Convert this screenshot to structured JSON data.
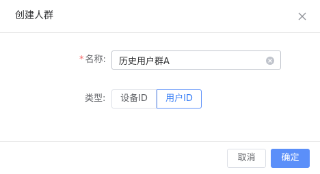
{
  "dialog": {
    "title": "创建人群",
    "close_icon": "close-icon"
  },
  "form": {
    "name": {
      "required_mark": "*",
      "label": "名称:",
      "value": "历史用户群A",
      "clear_icon": "clear-icon"
    },
    "type": {
      "label": "类型:",
      "options": [
        "设备ID",
        "用户ID"
      ],
      "selected": "用户ID"
    }
  },
  "footer": {
    "cancel_label": "取消",
    "confirm_label": "确定"
  },
  "colors": {
    "primary": "#5b8ff9",
    "required": "#f56c6c",
    "border": "#dcdfe6"
  }
}
